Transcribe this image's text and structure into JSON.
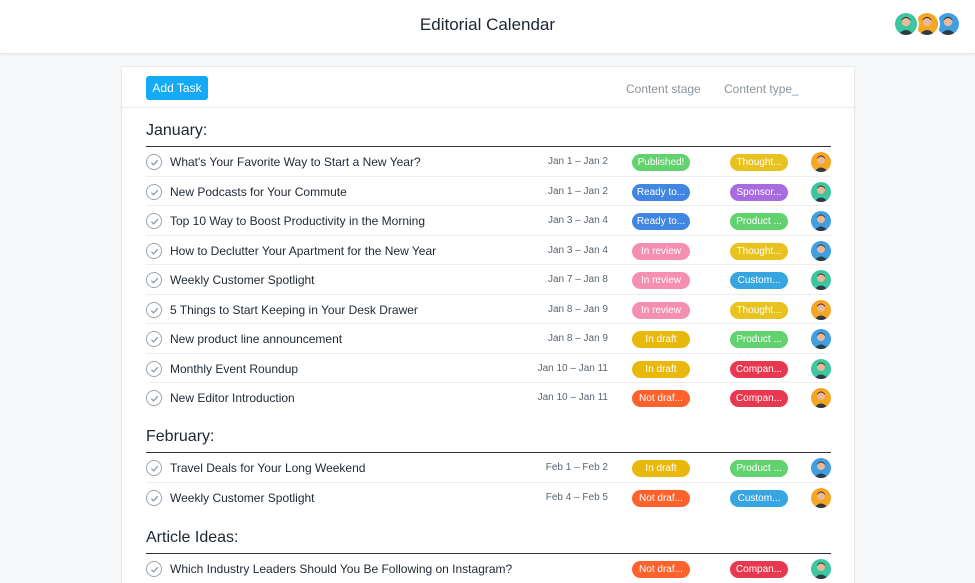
{
  "header": {
    "title": "Editorial Calendar",
    "members": [
      "teal",
      "orange",
      "blue"
    ]
  },
  "toolbar": {
    "add_task_label": "Add Task",
    "columns": [
      "Content stage",
      "Content type_"
    ]
  },
  "colors": {
    "add_button": "#14aaf5",
    "Published!": "#62d26f",
    "Ready to...": "#4186e0",
    "In review": "#f48fb1",
    "In draft": "#e8b80c",
    "Not draf...": "#fd612c",
    "Thought...": "#e8c21e",
    "Sponsor...": "#a86ce0",
    "Product ...": "#62d26f",
    "Custom...": "#37a5e0",
    "Compan...": "#e8384f"
  },
  "avatars": {
    "orange": "#f5a623",
    "teal": "#3cc7a0",
    "blue": "#3f9fe0"
  },
  "sections": [
    {
      "title": "January:",
      "tasks": [
        {
          "name": "What's Your Favorite Way to Start a New Year?",
          "date": "Jan 1 – Jan 2",
          "stage": "Published!",
          "type": "Thought...",
          "assignee": "orange"
        },
        {
          "name": "New Podcasts for Your Commute",
          "date": "Jan 1 – Jan 2",
          "stage": "Ready to...",
          "type": "Sponsor...",
          "assignee": "teal"
        },
        {
          "name": "Top 10 Way to Boost Productivity in the Morning",
          "date": "Jan 3 – Jan 4",
          "stage": "Ready to...",
          "type": "Product ...",
          "assignee": "blue"
        },
        {
          "name": "How to Declutter Your Apartment for the New Year",
          "date": "Jan 3 – Jan 4",
          "stage": "In review",
          "type": "Thought...",
          "assignee": "blue"
        },
        {
          "name": "Weekly Customer Spotlight",
          "date": "Jan 7 – Jan 8",
          "stage": "In review",
          "type": "Custom...",
          "assignee": "teal"
        },
        {
          "name": "5 Things to Start Keeping in Your Desk Drawer",
          "date": "Jan 8 – Jan 9",
          "stage": "In review",
          "type": "Thought...",
          "assignee": "orange"
        },
        {
          "name": "New product line announcement",
          "date": "Jan 8 – Jan 9",
          "stage": "In draft",
          "type": "Product ...",
          "assignee": "blue"
        },
        {
          "name": "Monthly Event Roundup",
          "date": "Jan 10 – Jan 11",
          "stage": "In draft",
          "type": "Compan...",
          "assignee": "teal"
        },
        {
          "name": "New Editor Introduction",
          "date": "Jan 10 – Jan 11",
          "stage": "Not draf...",
          "type": "Compan...",
          "assignee": "orange"
        }
      ]
    },
    {
      "title": "February:",
      "tasks": [
        {
          "name": "Travel Deals for Your Long Weekend",
          "date": "Feb 1 – Feb 2",
          "stage": "In draft",
          "type": "Product ...",
          "assignee": "blue"
        },
        {
          "name": "Weekly Customer Spotlight",
          "date": "Feb 4 – Feb 5",
          "stage": "Not draf...",
          "type": "Custom...",
          "assignee": "orange"
        }
      ]
    },
    {
      "title": "Article Ideas:",
      "tasks": [
        {
          "name": "Which Industry Leaders Should You Be Following on Instagram?",
          "date": "",
          "stage": "Not draf...",
          "type": "Compan...",
          "assignee": "teal"
        }
      ]
    }
  ]
}
